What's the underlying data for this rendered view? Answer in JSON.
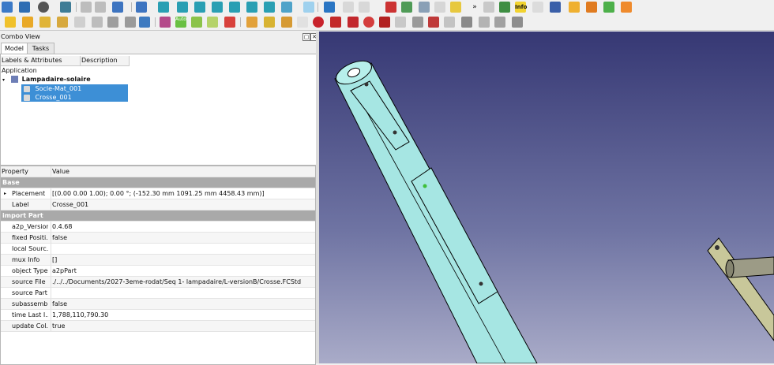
{
  "combo_view": {
    "title": "Combo View",
    "tabs": [
      "Model",
      "Tasks"
    ],
    "active_tab": "Model"
  },
  "tree": {
    "columns": [
      "Labels & Attributes",
      "Description"
    ],
    "application_label": "Application",
    "document": "Lampadaire-solaire",
    "items": [
      "Socle-Mat_001",
      "Crosse_001"
    ]
  },
  "properties": {
    "columns": [
      "Property",
      "Value"
    ],
    "groups": [
      {
        "name": "Base",
        "rows": [
          {
            "name": "Placement",
            "value": "[(0.00 0.00 1.00); 0.00 °; (-152.30 mm  1091.25 mm  4458.43 mm)]"
          },
          {
            "name": "Label",
            "value": "Crosse_001"
          }
        ]
      },
      {
        "name": "import Part",
        "rows": [
          {
            "name": "a2p_Version",
            "value": "0.4.68"
          },
          {
            "name": "fixed Positi...",
            "value": "false"
          },
          {
            "name": "local Sourc...",
            "value": ""
          },
          {
            "name": "mux Info",
            "value": "[]"
          },
          {
            "name": "object Type",
            "value": "a2pPart"
          },
          {
            "name": "source File",
            "value": "./../../Documents/2027-3eme-rodat/Seq 1- lampadaire/L-versionB/Crosse.FCStd"
          },
          {
            "name": "source Part",
            "value": ""
          },
          {
            "name": "subassemb...",
            "value": "false"
          },
          {
            "name": "time Last I...",
            "value": "1,788,110,790.30"
          },
          {
            "name": "update Col...",
            "value": "true"
          }
        ]
      }
    ]
  },
  "toolbar2": {
    "auto_label": "Auto"
  },
  "toolbar1": {
    "info_label": "Info"
  },
  "colors": {
    "selection": "#3d8fd6",
    "group_row": "#a9a9a9",
    "viewport_top": "#363874",
    "viewport_bottom": "#a9abc8",
    "part_fill": "#a6e6e3"
  }
}
